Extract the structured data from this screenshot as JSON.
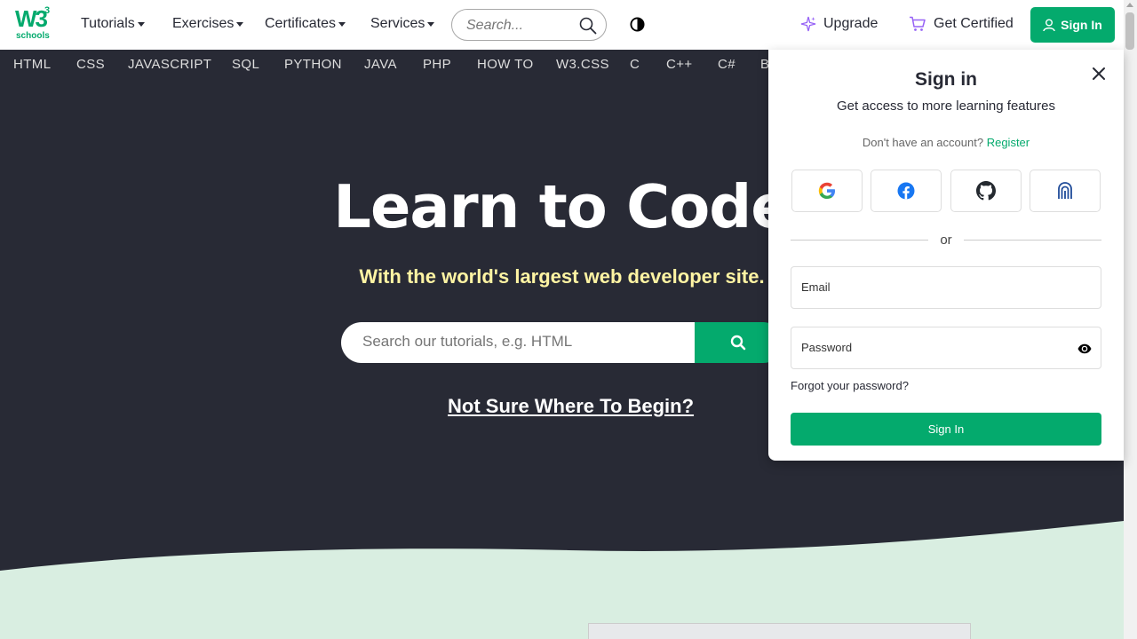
{
  "logo": {
    "main": "W3",
    "sup": "3",
    "sub": "schools"
  },
  "nav": {
    "tutorials": "Tutorials",
    "exercises": "Exercises",
    "certificates": "Certificates",
    "services": "Services",
    "search_placeholder": "Search...",
    "upgrade": "Upgrade",
    "get_certified": "Get Certified",
    "sign_in": "Sign In"
  },
  "subnav": [
    "HTML",
    "CSS",
    "JAVASCRIPT",
    "SQL",
    "PYTHON",
    "JAVA",
    "PHP",
    "HOW TO",
    "W3.CSS",
    "C",
    "C++",
    "C#",
    "B"
  ],
  "hero": {
    "title": "Learn to Code",
    "subtitle": "With the world's largest web developer site.",
    "search_placeholder": "Search our tutorials, e.g. HTML",
    "not_sure": "Not Sure Where To Begin?"
  },
  "signin_panel": {
    "title": "Sign in",
    "subtitle": "Get access to more learning features",
    "no_account": "Don't have an account?",
    "register": "Register",
    "providers": [
      "google-icon",
      "facebook-icon",
      "github-icon",
      "passkey-icon"
    ],
    "or": "or",
    "email_placeholder": "Email",
    "password_placeholder": "Password",
    "forgot": "Forgot your password?",
    "submit": "Sign In"
  },
  "colors": {
    "brand_green": "#04AA6D",
    "hero_bg": "#282A35",
    "hero_subtitle": "#FFF4A3",
    "wave_bg": "#D9EEE1"
  }
}
